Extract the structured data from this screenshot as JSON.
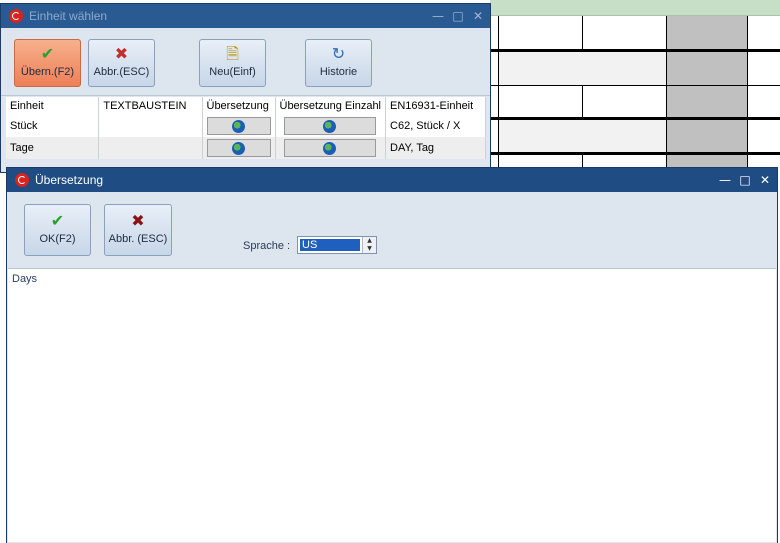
{
  "window1": {
    "title": "Einheit wählen",
    "toolbar": {
      "accept_label": "Übern.(F2)",
      "cancel_label": "Abbr.(ESC)",
      "new_label": "Neu(Einf)",
      "history_label": "Historie"
    },
    "columns": [
      "Einheit",
      "TEXTBAUSTEIN",
      "Übersetzung",
      "Übersetzung Einzahl",
      "EN16931-Einheit"
    ],
    "rows": [
      {
        "einheit": "Stück",
        "textbaustein": "",
        "en16931": "C62, Stück / X"
      },
      {
        "einheit": "Tage",
        "textbaustein": "",
        "en16931": "DAY, Tag"
      }
    ]
  },
  "window2": {
    "title": "Übersetzung",
    "toolbar": {
      "ok_label": "OK(F2)",
      "cancel_label": "Abbr. (ESC)"
    },
    "sprache_label": "Sprache :",
    "sprache_value": "US",
    "text_content": "Days"
  },
  "colors": {
    "titlebar": "#1f4c83",
    "accept_button": "#ee7f57",
    "check_green": "#2e9e2e",
    "cancel_red": "#c0302a",
    "selection": "#1f5fbf"
  },
  "icons": {
    "check": "check-icon",
    "cross": "cross-icon",
    "new": "new-document-icon",
    "history": "history-icon",
    "globe": "globe-icon"
  }
}
